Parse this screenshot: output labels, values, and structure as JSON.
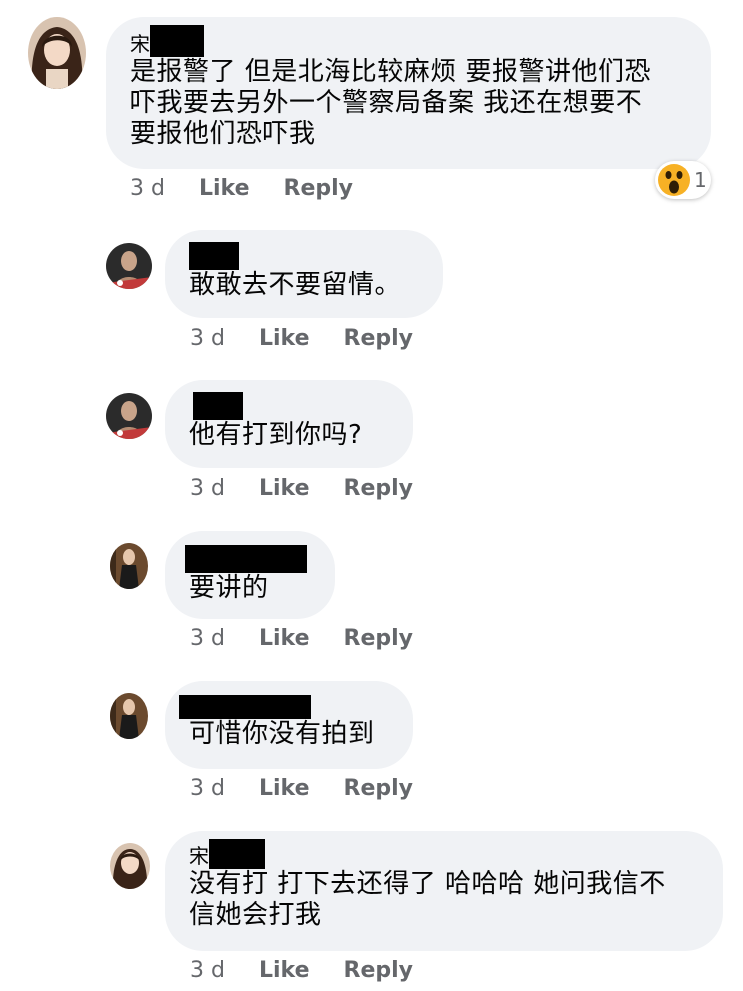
{
  "comments": [
    {
      "name_prefix": "宋",
      "text_lines": [
        "是报警了 但是北海比较麻烦 要报警讲他们恐",
        "吓我要去另外一个警察局备案 我还在想要不",
        "要报他们恐吓我"
      ],
      "time": "3 d",
      "like": "Like",
      "reply": "Reply",
      "reaction": {
        "icon": "wow-emoji-icon",
        "count": "1"
      }
    },
    {
      "name_prefix": "",
      "text_lines": [
        "敢敢去不要留情。"
      ],
      "time": "3 d",
      "like": "Like",
      "reply": "Reply"
    },
    {
      "name_prefix": "",
      "text_lines": [
        "他有打到你吗?"
      ],
      "time": "3 d",
      "like": "Like",
      "reply": "Reply"
    },
    {
      "name_prefix": "",
      "text_lines": [
        "要讲的"
      ],
      "time": "3 d",
      "like": "Like",
      "reply": "Reply"
    },
    {
      "name_prefix": "",
      "text_lines": [
        "可惜你没有拍到"
      ],
      "time": "3 d",
      "like": "Like",
      "reply": "Reply"
    },
    {
      "name_prefix": "宋",
      "text_lines": [
        "没有打 打下去还得了 哈哈哈 她问我信不",
        "信她会打我"
      ],
      "time": "3 d",
      "like": "Like",
      "reply": "Reply"
    }
  ],
  "colors": {
    "bubble": "#f0f2f5",
    "meta": "#65676b",
    "text": "#050505",
    "redaction": "#000000"
  }
}
